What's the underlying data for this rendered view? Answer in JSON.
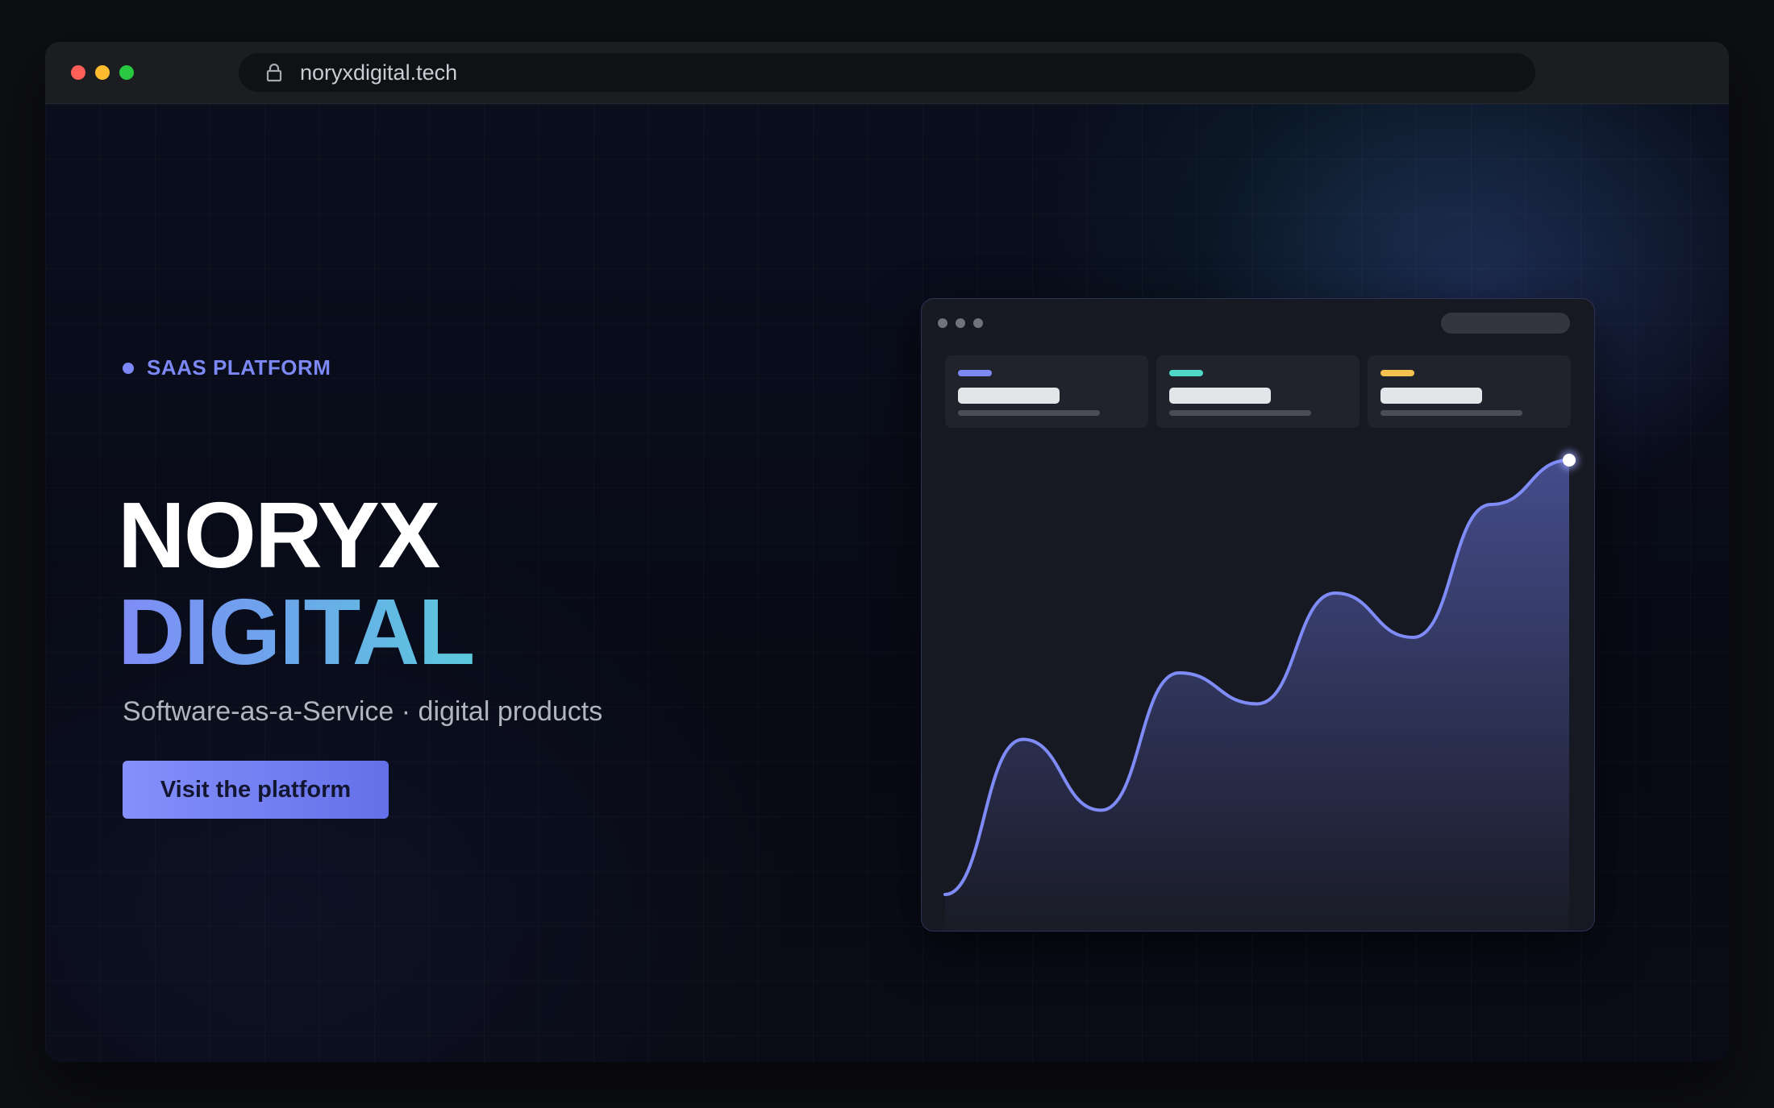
{
  "browser": {
    "url": "noryxdigital.tech",
    "traffic_colors": [
      "#ff5f57",
      "#febc2e",
      "#28c840"
    ]
  },
  "hero": {
    "eyebrow": "SAAS PLATFORM",
    "title_line1": "NORYX",
    "title_line2": "DIGITAL",
    "subtitle": "Software-as-a-Service · digital products",
    "cta_label": "Visit the platform"
  },
  "preview": {
    "stat_accents": [
      "#7c88f5",
      "#4fd8c8",
      "#f2c14e"
    ],
    "line_color": "#7f8cf7"
  },
  "chart_data": {
    "type": "area",
    "title": "",
    "xlabel": "",
    "ylabel": "",
    "values": [
      2,
      37,
      21,
      52,
      45,
      70,
      60,
      90,
      100
    ],
    "ylim": [
      0,
      100
    ]
  }
}
